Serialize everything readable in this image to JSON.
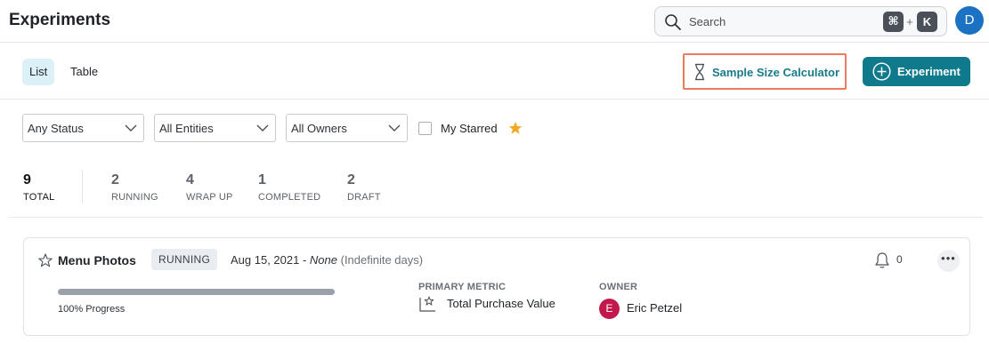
{
  "header": {
    "title": "Experiments",
    "search": {
      "placeholder": "Search",
      "shortcut_cmd": "⌘",
      "shortcut_plus": "+",
      "shortcut_key": "K"
    },
    "user_avatar_initial": "D"
  },
  "toolbar": {
    "tabs": [
      {
        "label": "List",
        "selected": true
      },
      {
        "label": "Table",
        "selected": false
      }
    ],
    "sample_size_calculator_label": "Sample Size Calculator",
    "new_experiment_label": "Experiment"
  },
  "filters": {
    "status": "Any Status",
    "entities": "All Entities",
    "owners": "All Owners",
    "my_starred_label": "My Starred",
    "my_starred_checked": false
  },
  "stats": [
    {
      "count": "9",
      "label": "TOTAL"
    },
    {
      "count": "2",
      "label": "RUNNING"
    },
    {
      "count": "4",
      "label": "WRAP UP"
    },
    {
      "count": "1",
      "label": "COMPLETED"
    },
    {
      "count": "2",
      "label": "DRAFT"
    }
  ],
  "experiments": [
    {
      "name": "Menu Photos",
      "status": "RUNNING",
      "start_date": "Aug 15, 2021 - ",
      "end_date": "None",
      "duration": "(Indefinite days)",
      "notifications": "0",
      "progress_percent": 100,
      "progress_label": "100% Progress",
      "primary_metric_heading": "PRIMARY METRIC",
      "primary_metric": "Total Purchase Value",
      "owner_heading": "OWNER",
      "owner_initial": "E",
      "owner_name": "Eric Petzel"
    }
  ],
  "colors": {
    "accent": "#0e7a8c",
    "highlight_border": "#ec7a5f",
    "avatar_user": "#1b72c2",
    "avatar_owner": "#c2184c",
    "star": "#f5a623"
  },
  "icons": {
    "search": "search-icon",
    "hourglass": "hourglass-icon",
    "add": "plus-circle-icon",
    "chevron": "chevron-down-icon",
    "star": "star-icon",
    "bell": "bell-icon",
    "more": "more-icon",
    "metric": "chart-star-icon"
  }
}
